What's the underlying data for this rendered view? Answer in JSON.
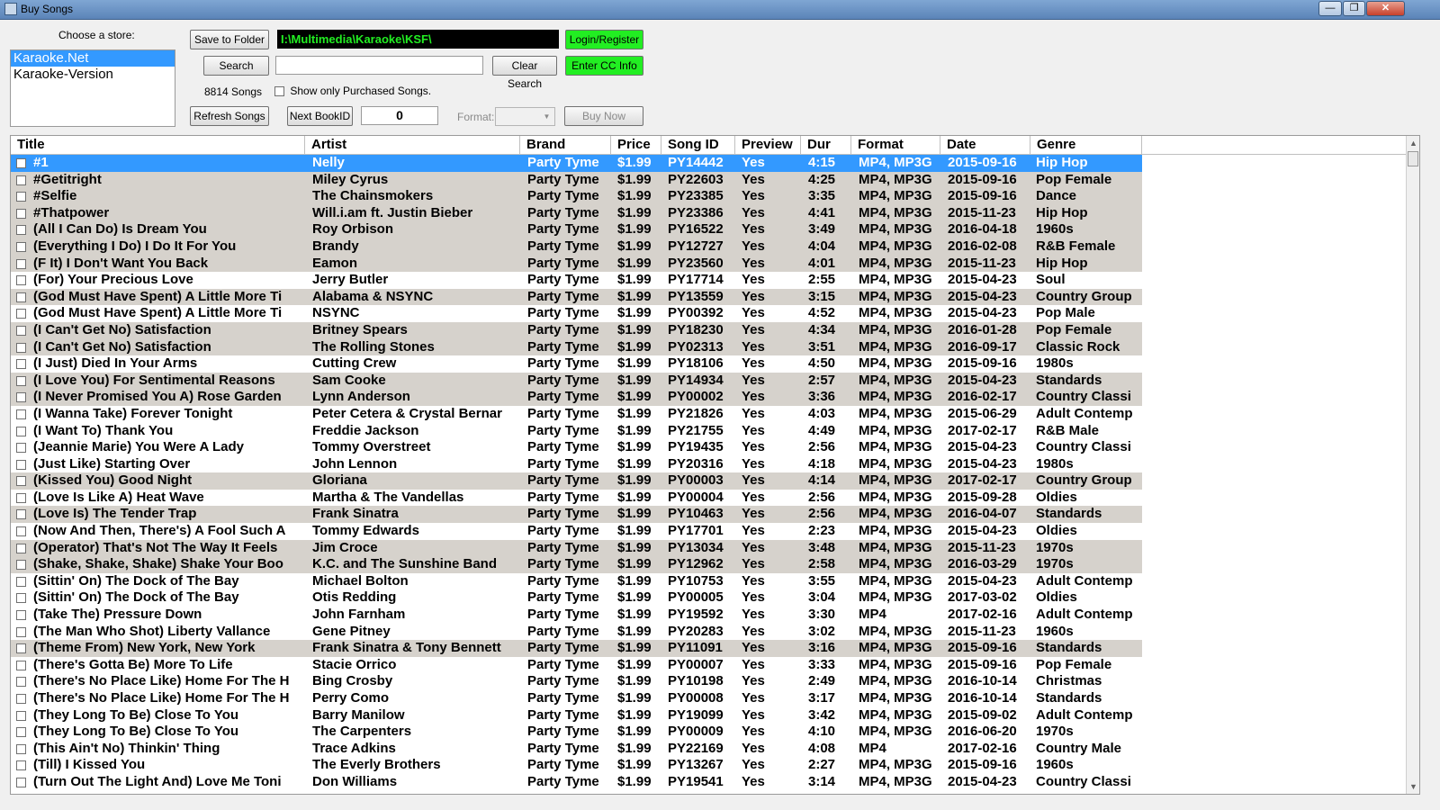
{
  "window": {
    "title": "Buy Songs",
    "minimize": "—",
    "maximize": "❐",
    "close": "✕"
  },
  "store": {
    "label": "Choose a store:",
    "items": [
      "Karaoke.Net",
      "Karaoke-Version"
    ],
    "selected": 0
  },
  "toolbar": {
    "save_folder_label": "Save to Folder",
    "folder_path": "I:\\Multimedia\\Karaoke\\KSF\\",
    "login_label": "Login/Register",
    "search_label": "Search",
    "search_value": "",
    "clear_search_label": "Clear Search",
    "enter_cc_label": "Enter CC Info",
    "song_count": "8814 Songs",
    "show_purchased_label": "Show only Purchased Songs.",
    "refresh_label": "Refresh Songs",
    "next_bookid_label": "Next BookID",
    "bookid_value": "0",
    "format_label": "Format:",
    "format_value": "",
    "buy_now_label": "Buy Now"
  },
  "table": {
    "columns": [
      "Title",
      "Artist",
      "Brand",
      "Price",
      "Song ID",
      "Preview",
      "Dur",
      "Format",
      "Date",
      "Genre"
    ],
    "selected_row": 0,
    "rows": [
      [
        "#1",
        "Nelly",
        "Party Tyme",
        "$1.99",
        "PY14442",
        "Yes",
        "4:15",
        "MP4, MP3G",
        "2015-09-16",
        "Hip Hop"
      ],
      [
        "#Getitright",
        "Miley Cyrus",
        "Party Tyme",
        "$1.99",
        "PY22603",
        "Yes",
        "4:25",
        "MP4, MP3G",
        "2015-09-16",
        "Pop Female"
      ],
      [
        "#Selfie",
        "The Chainsmokers",
        "Party Tyme",
        "$1.99",
        "PY23385",
        "Yes",
        "3:35",
        "MP4, MP3G",
        "2015-09-16",
        "Dance"
      ],
      [
        "#Thatpower",
        "Will.i.am ft. Justin Bieber",
        "Party Tyme",
        "$1.99",
        "PY23386",
        "Yes",
        "4:41",
        "MP4, MP3G",
        "2015-11-23",
        "Hip Hop"
      ],
      [
        "(All I Can Do) Is Dream You",
        "Roy Orbison",
        "Party Tyme",
        "$1.99",
        "PY16522",
        "Yes",
        "3:49",
        "MP4, MP3G",
        "2016-04-18",
        "1960s"
      ],
      [
        "(Everything I Do) I Do It For You",
        "Brandy",
        "Party Tyme",
        "$1.99",
        "PY12727",
        "Yes",
        "4:04",
        "MP4, MP3G",
        "2016-02-08",
        "R&B Female"
      ],
      [
        "(F It) I Don't Want You Back",
        "Eamon",
        "Party Tyme",
        "$1.99",
        "PY23560",
        "Yes",
        "4:01",
        "MP4, MP3G",
        "2015-11-23",
        "Hip Hop"
      ],
      [
        "(For) Your Precious Love",
        "Jerry Butler",
        "Party Tyme",
        "$1.99",
        "PY17714",
        "Yes",
        "2:55",
        "MP4, MP3G",
        "2015-04-23",
        "Soul"
      ],
      [
        "(God Must Have Spent) A Little More Ti",
        "Alabama & NSYNC",
        "Party Tyme",
        "$1.99",
        "PY13559",
        "Yes",
        "3:15",
        "MP4, MP3G",
        "2015-04-23",
        "Country Group"
      ],
      [
        "(God Must Have Spent) A Little More Ti",
        "NSYNC",
        "Party Tyme",
        "$1.99",
        "PY00392",
        "Yes",
        "4:52",
        "MP4, MP3G",
        "2015-04-23",
        "Pop Male"
      ],
      [
        "(I Can't Get No) Satisfaction",
        "Britney Spears",
        "Party Tyme",
        "$1.99",
        "PY18230",
        "Yes",
        "4:34",
        "MP4, MP3G",
        "2016-01-28",
        "Pop Female"
      ],
      [
        "(I Can't Get No) Satisfaction",
        "The Rolling Stones",
        "Party Tyme",
        "$1.99",
        "PY02313",
        "Yes",
        "3:51",
        "MP4, MP3G",
        "2016-09-17",
        "Classic Rock"
      ],
      [
        "(I Just) Died In Your Arms",
        "Cutting Crew",
        "Party Tyme",
        "$1.99",
        "PY18106",
        "Yes",
        "4:50",
        "MP4, MP3G",
        "2015-09-16",
        "1980s"
      ],
      [
        "(I Love You) For Sentimental Reasons",
        "Sam Cooke",
        "Party Tyme",
        "$1.99",
        "PY14934",
        "Yes",
        "2:57",
        "MP4, MP3G",
        "2015-04-23",
        "Standards"
      ],
      [
        "(I Never Promised You A) Rose Garden",
        "Lynn Anderson",
        "Party Tyme",
        "$1.99",
        "PY00002",
        "Yes",
        "3:36",
        "MP4, MP3G",
        "2016-02-17",
        "Country Classi"
      ],
      [
        "(I Wanna Take) Forever Tonight",
        "Peter Cetera & Crystal Bernar",
        "Party Tyme",
        "$1.99",
        "PY21826",
        "Yes",
        "4:03",
        "MP4, MP3G",
        "2015-06-29",
        "Adult Contemp"
      ],
      [
        "(I Want To) Thank You",
        "Freddie Jackson",
        "Party Tyme",
        "$1.99",
        "PY21755",
        "Yes",
        "4:49",
        "MP4, MP3G",
        "2017-02-17",
        "R&B Male"
      ],
      [
        "(Jeannie Marie) You Were A Lady",
        "Tommy Overstreet",
        "Party Tyme",
        "$1.99",
        "PY19435",
        "Yes",
        "2:56",
        "MP4, MP3G",
        "2015-04-23",
        "Country Classi"
      ],
      [
        "(Just Like) Starting Over",
        "John Lennon",
        "Party Tyme",
        "$1.99",
        "PY20316",
        "Yes",
        "4:18",
        "MP4, MP3G",
        "2015-04-23",
        "1980s"
      ],
      [
        "(Kissed You) Good Night",
        "Gloriana",
        "Party Tyme",
        "$1.99",
        "PY00003",
        "Yes",
        "4:14",
        "MP4, MP3G",
        "2017-02-17",
        "Country Group"
      ],
      [
        "(Love Is Like A) Heat Wave",
        "Martha & The Vandellas",
        "Party Tyme",
        "$1.99",
        "PY00004",
        "Yes",
        "2:56",
        "MP4, MP3G",
        "2015-09-28",
        "Oldies"
      ],
      [
        "(Love Is) The Tender Trap",
        "Frank Sinatra",
        "Party Tyme",
        "$1.99",
        "PY10463",
        "Yes",
        "2:56",
        "MP4, MP3G",
        "2016-04-07",
        "Standards"
      ],
      [
        "(Now And Then, There's) A Fool Such A",
        "Tommy Edwards",
        "Party Tyme",
        "$1.99",
        "PY17701",
        "Yes",
        "2:23",
        "MP4, MP3G",
        "2015-04-23",
        "Oldies"
      ],
      [
        "(Operator) That's Not The Way It Feels",
        "Jim Croce",
        "Party Tyme",
        "$1.99",
        "PY13034",
        "Yes",
        "3:48",
        "MP4, MP3G",
        "2015-11-23",
        "1970s"
      ],
      [
        "(Shake, Shake, Shake) Shake Your Boo",
        "K.C. and The Sunshine Band",
        "Party Tyme",
        "$1.99",
        "PY12962",
        "Yes",
        "2:58",
        "MP4, MP3G",
        "2016-03-29",
        "1970s"
      ],
      [
        "(Sittin' On) The Dock of The Bay",
        "Michael Bolton",
        "Party Tyme",
        "$1.99",
        "PY10753",
        "Yes",
        "3:55",
        "MP4, MP3G",
        "2015-04-23",
        "Adult Contemp"
      ],
      [
        "(Sittin' On) The Dock of The Bay",
        "Otis Redding",
        "Party Tyme",
        "$1.99",
        "PY00005",
        "Yes",
        "3:04",
        "MP4, MP3G",
        "2017-03-02",
        "Oldies"
      ],
      [
        "(Take The) Pressure Down",
        "John Farnham",
        "Party Tyme",
        "$1.99",
        "PY19592",
        "Yes",
        "3:30",
        "MP4",
        "2017-02-16",
        "Adult Contemp"
      ],
      [
        "(The Man Who Shot) Liberty Vallance",
        "Gene Pitney",
        "Party Tyme",
        "$1.99",
        "PY20283",
        "Yes",
        "3:02",
        "MP4, MP3G",
        "2015-11-23",
        "1960s"
      ],
      [
        "(Theme From) New York, New York",
        "Frank Sinatra & Tony Bennett",
        "Party Tyme",
        "$1.99",
        "PY11091",
        "Yes",
        "3:16",
        "MP4, MP3G",
        "2015-09-16",
        "Standards"
      ],
      [
        "(There's Gotta Be) More To Life",
        "Stacie Orrico",
        "Party Tyme",
        "$1.99",
        "PY00007",
        "Yes",
        "3:33",
        "MP4, MP3G",
        "2015-09-16",
        "Pop Female"
      ],
      [
        "(There's No Place Like) Home For The H",
        "Bing Crosby",
        "Party Tyme",
        "$1.99",
        "PY10198",
        "Yes",
        "2:49",
        "MP4, MP3G",
        "2016-10-14",
        "Christmas"
      ],
      [
        "(There's No Place Like) Home For The H",
        "Perry Como",
        "Party Tyme",
        "$1.99",
        "PY00008",
        "Yes",
        "3:17",
        "MP4, MP3G",
        "2016-10-14",
        "Standards"
      ],
      [
        "(They Long To Be) Close To You",
        "Barry Manilow",
        "Party Tyme",
        "$1.99",
        "PY19099",
        "Yes",
        "3:42",
        "MP4, MP3G",
        "2015-09-02",
        "Adult Contemp"
      ],
      [
        "(They Long To Be) Close To You",
        "The Carpenters",
        "Party Tyme",
        "$1.99",
        "PY00009",
        "Yes",
        "4:10",
        "MP4, MP3G",
        "2016-06-20",
        "1970s"
      ],
      [
        "(This Ain't No) Thinkin' Thing",
        "Trace Adkins",
        "Party Tyme",
        "$1.99",
        "PY22169",
        "Yes",
        "4:08",
        "MP4",
        "2017-02-16",
        "Country Male"
      ],
      [
        "(Till) I Kissed You",
        "The Everly Brothers",
        "Party Tyme",
        "$1.99",
        "PY13267",
        "Yes",
        "2:27",
        "MP4, MP3G",
        "2015-09-16",
        "1960s"
      ],
      [
        "(Turn Out The Light And) Love Me Toni",
        "Don Williams",
        "Party Tyme",
        "$1.99",
        "PY19541",
        "Yes",
        "3:14",
        "MP4, MP3G",
        "2015-04-23",
        "Country Classi"
      ]
    ]
  },
  "shaded_rows": [
    1,
    2,
    3,
    4,
    5,
    6,
    8,
    10,
    11,
    13,
    14,
    19,
    21,
    23,
    24,
    29
  ]
}
